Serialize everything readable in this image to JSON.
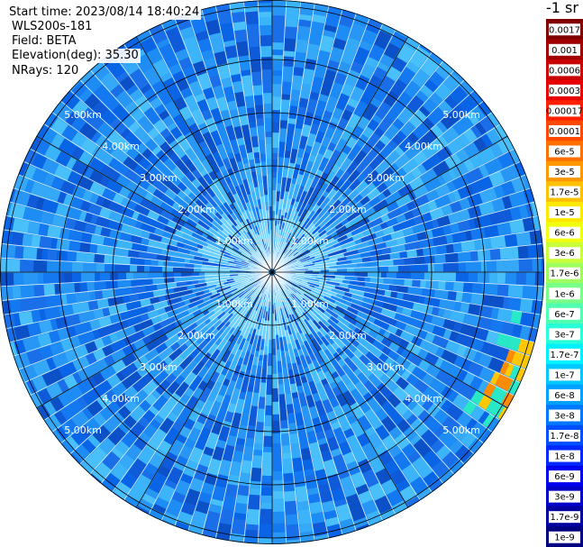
{
  "header": {
    "start_time": "Start time: 2023/08/14 18:40:24",
    "instrument": "WLS200s-181",
    "field": "Field: BETA",
    "elevation": "Elevation(deg): 35.30",
    "nrays": "NRays: 120"
  },
  "units_label": "-1 sr",
  "range_ring_labels": [
    "1.00km",
    "2.00km",
    "3.00km",
    "4.00km",
    "5.00km"
  ],
  "colorbar": {
    "labels": [
      "0.0017",
      "0.001",
      "0.0006",
      "0.0003",
      "0.00017",
      "0.0001",
      "6e-5",
      "3e-5",
      "1.7e-5",
      "1e-5",
      "6e-6",
      "3e-6",
      "1.7e-6",
      "1e-6",
      "6e-7",
      "3e-7",
      "1.7e-7",
      "1e-7",
      "6e-8",
      "3e-8",
      "1.7e-8",
      "1e-8",
      "6e-9",
      "3e-9",
      "1.7e-9",
      "1e-9"
    ],
    "colors": [
      "#800000",
      "#a00000",
      "#c80000",
      "#e80000",
      "#ff2000",
      "#ff4800",
      "#ff7000",
      "#ff9800",
      "#ffc000",
      "#ffe800",
      "#f0ff10",
      "#c8ff38",
      "#a0ff60",
      "#78ff88",
      "#50ffb0",
      "#28ffd8",
      "#00f0ff",
      "#00c8ff",
      "#00a0ff",
      "#0078ff",
      "#0050ff",
      "#0028ff",
      "#0000f0",
      "#0000c8",
      "#0000a0",
      "#000080"
    ]
  }
}
